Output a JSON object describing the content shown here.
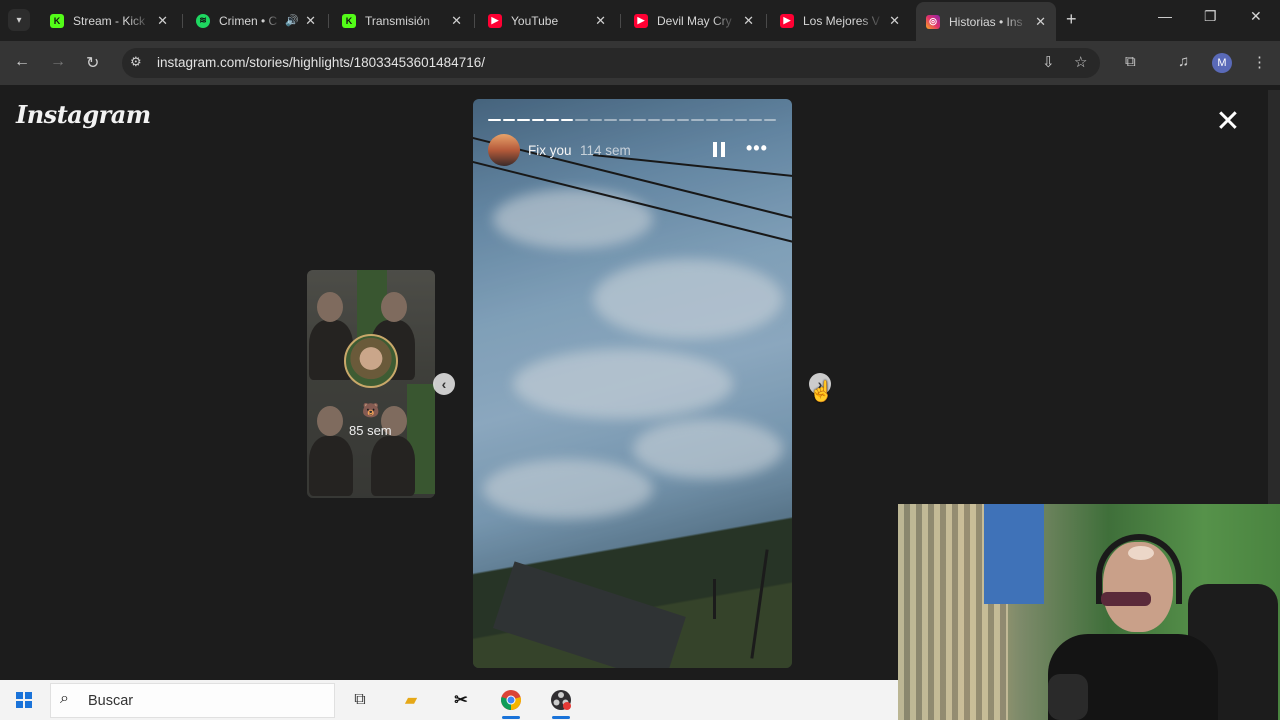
{
  "tabs": [
    {
      "title": "Stream - Kick",
      "favicon": "kick-icon",
      "color": "#53fc18"
    },
    {
      "title": "Crimen • C",
      "favicon": "spotify-icon",
      "color": "#1ed760",
      "audio": true
    },
    {
      "title": "Transmisión",
      "favicon": "kick-icon",
      "color": "#53fc18"
    },
    {
      "title": "YouTube",
      "favicon": "youtube-icon",
      "color": "#ff0033"
    },
    {
      "title": "Devil May Cry",
      "favicon": "youtube-icon",
      "color": "#ff0033"
    },
    {
      "title": "Los Mejores V",
      "favicon": "youtube-icon",
      "color": "#ff0033"
    },
    {
      "title": "Historias • Ins",
      "favicon": "instagram-icon",
      "color": "#e1306c",
      "active": true
    }
  ],
  "browser": {
    "url": "instagram.com/stories/highlights/18033453601484716/",
    "profile_initial": "M"
  },
  "instagram": {
    "logo": "Instagram",
    "previous_story": {
      "time": "85 sem"
    },
    "story": {
      "username": "Fix you",
      "time": "114 sem",
      "progress_segments": 20,
      "progress_done": 6
    }
  },
  "taskbar": {
    "search_placeholder": "Buscar",
    "apps": [
      "task-view-icon",
      "file-explorer-icon",
      "capcut-icon",
      "chrome-icon",
      "obs-icon"
    ]
  }
}
